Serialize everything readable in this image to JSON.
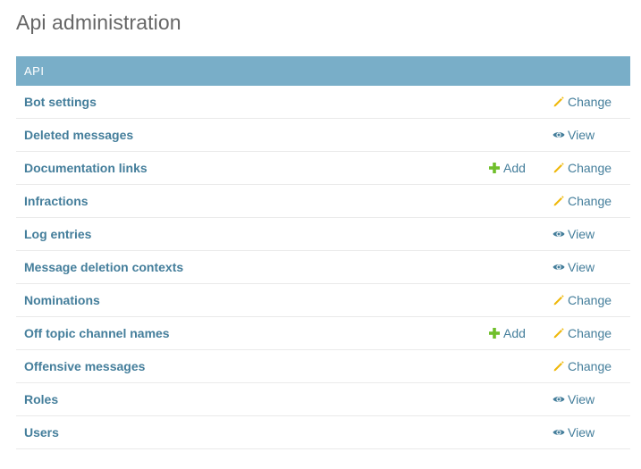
{
  "page": {
    "title": "Api administration"
  },
  "module": {
    "caption": "API",
    "rows": [
      {
        "name": "Bot settings",
        "add": null,
        "action": {
          "type": "change",
          "label": "Change"
        }
      },
      {
        "name": "Deleted messages",
        "add": null,
        "action": {
          "type": "view",
          "label": "View"
        }
      },
      {
        "name": "Documentation links",
        "add": "Add",
        "action": {
          "type": "change",
          "label": "Change"
        }
      },
      {
        "name": "Infractions",
        "add": null,
        "action": {
          "type": "change",
          "label": "Change"
        }
      },
      {
        "name": "Log entries",
        "add": null,
        "action": {
          "type": "view",
          "label": "View"
        }
      },
      {
        "name": "Message deletion contexts",
        "add": null,
        "action": {
          "type": "view",
          "label": "View"
        }
      },
      {
        "name": "Nominations",
        "add": null,
        "action": {
          "type": "change",
          "label": "Change"
        }
      },
      {
        "name": "Off topic channel names",
        "add": "Add",
        "action": {
          "type": "change",
          "label": "Change"
        }
      },
      {
        "name": "Offensive messages",
        "add": null,
        "action": {
          "type": "change",
          "label": "Change"
        }
      },
      {
        "name": "Roles",
        "add": null,
        "action": {
          "type": "view",
          "label": "View"
        }
      },
      {
        "name": "Users",
        "add": null,
        "action": {
          "type": "view",
          "label": "View"
        }
      }
    ]
  },
  "colors": {
    "caption_bg": "#79aec8",
    "link": "#447e9b",
    "title": "#666666",
    "add_icon": "#70bf2b",
    "change_icon": "#efb80b",
    "view_icon": "#447e9b"
  },
  "icons": {
    "add": "plus-icon",
    "change": "pencil-icon",
    "view": "eye-icon"
  }
}
